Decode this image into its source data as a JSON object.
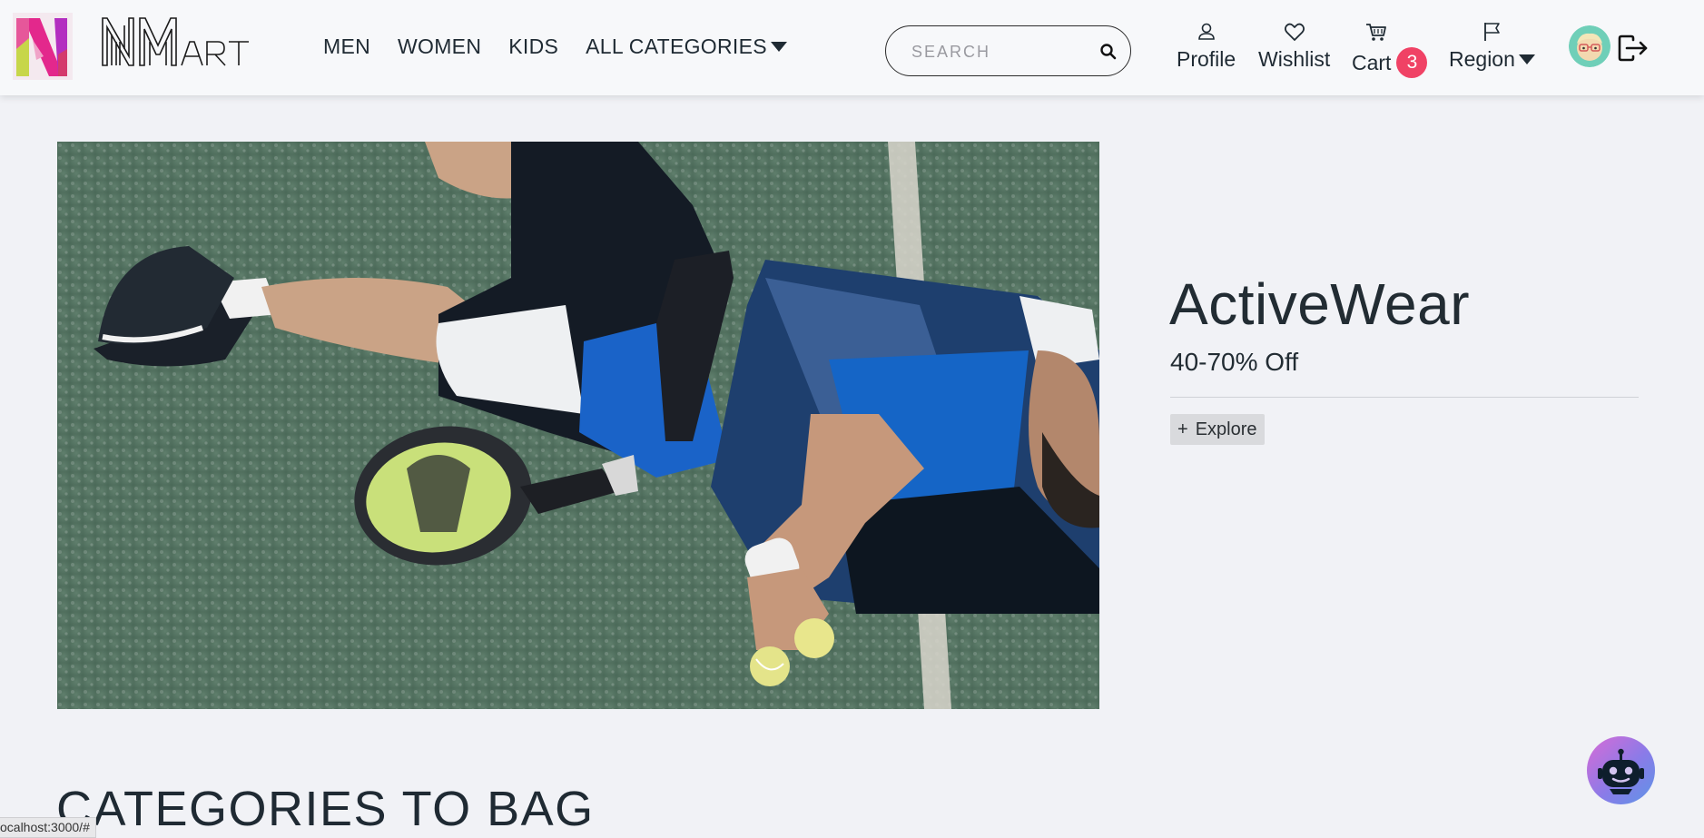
{
  "brand": {
    "name": "NMart",
    "logo_text": "NMART"
  },
  "nav": {
    "items": [
      {
        "label": "MEN"
      },
      {
        "label": "WOMEN"
      },
      {
        "label": "KIDS"
      },
      {
        "label": "ALL CATEGORIES"
      }
    ]
  },
  "search": {
    "placeholder": "SEARCH"
  },
  "header_actions": {
    "profile": "Profile",
    "wishlist": "Wishlist",
    "cart": "Cart",
    "cart_count": "3",
    "region": "Region"
  },
  "hero": {
    "title": "ActiveWear",
    "subtitle": "40-70% Off",
    "explore_icon": "+",
    "explore_label": "Explore"
  },
  "sections": {
    "categories_title": "CATEGORIES TO BAG"
  },
  "status_bar": {
    "url": "ocalhost:3000/#"
  },
  "colors": {
    "background": "#f1f2f6",
    "cart_badge": "#f04265",
    "text": "#1f2a33"
  },
  "icons": {
    "search": "search-icon",
    "profile": "user-icon",
    "wishlist": "heart-icon",
    "cart": "cart-icon",
    "region": "flag-icon",
    "logout": "logout-icon",
    "chatbot": "robot-icon"
  }
}
